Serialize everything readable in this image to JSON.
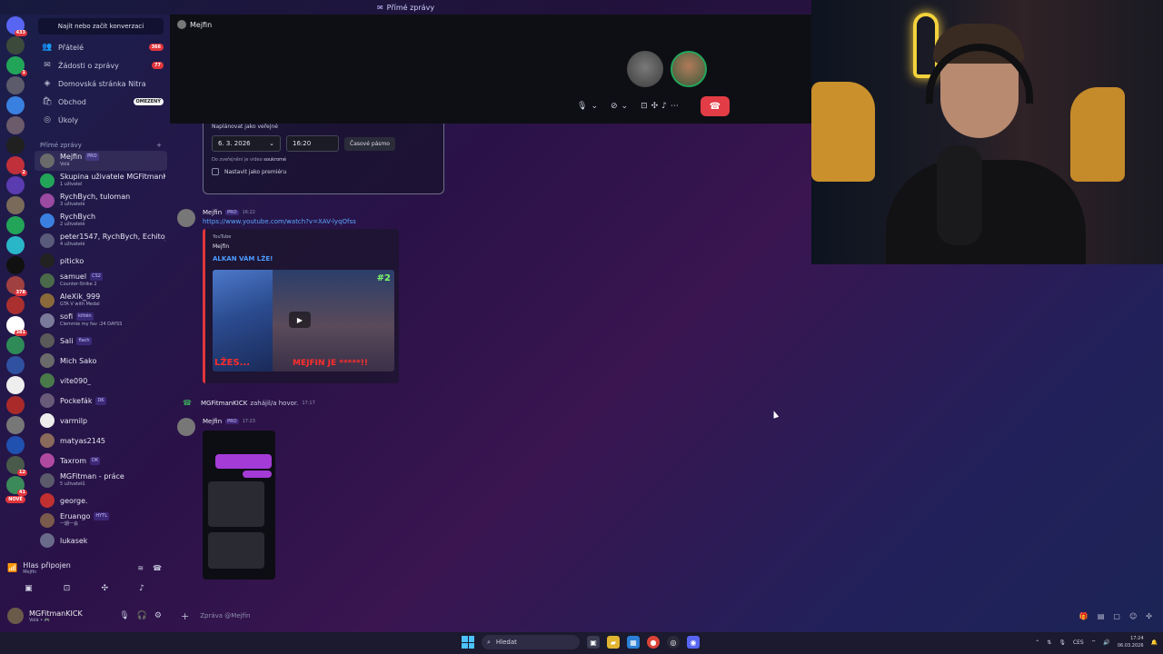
{
  "window": {
    "title": "Přímé zprávy"
  },
  "rail": {
    "servers": [
      {
        "badge": "433",
        "color": "#5865f2"
      },
      {
        "badge": "",
        "color": "#3c4a3c"
      },
      {
        "badge": "1",
        "color": "#23a559"
      },
      {
        "badge": "",
        "color": "#5b5b6b"
      },
      {
        "badge": "",
        "color": "#3a80e0"
      },
      {
        "badge": "",
        "color": "#6b5b6b"
      },
      {
        "badge": "",
        "color": "#202020"
      },
      {
        "badge": "2",
        "color": "#c0303a"
      },
      {
        "badge": "",
        "color": "#5b3bb0"
      },
      {
        "badge": "",
        "color": "#7a6a5a"
      },
      {
        "badge": "",
        "color": "#23a559"
      },
      {
        "badge": "",
        "color": "#29b6c8"
      },
      {
        "badge": "",
        "color": "#111111"
      },
      {
        "badge": "378",
        "color": "#a04040"
      },
      {
        "badge": "",
        "color": "#aa3030"
      },
      {
        "badge": "381",
        "color": "#ffffff"
      },
      {
        "badge": "",
        "color": "#2e8b57"
      },
      {
        "badge": "",
        "color": "#3050a0"
      },
      {
        "badge": "",
        "color": "#eeeeee"
      },
      {
        "badge": "",
        "color": "#aa2a2a"
      },
      {
        "badge": "",
        "color": "#777777"
      },
      {
        "badge": "",
        "color": "#2050b0"
      },
      {
        "badge": "12",
        "color": "#4a5a4a"
      },
      {
        "badge": "41",
        "color": "#3a8a5a"
      }
    ],
    "new_label": "NOVÉ"
  },
  "sidebar": {
    "search_label": "Najít nebo začít konverzaci",
    "nav": [
      {
        "label": "Přátelé",
        "icon": "friends-icon",
        "badge": "366"
      },
      {
        "label": "Žádosti o zprávy",
        "icon": "envelope-icon",
        "badge": "77"
      },
      {
        "label": "Domovská stránka Nitra",
        "icon": "nitro-icon",
        "badge": ""
      },
      {
        "label": "Obchod",
        "icon": "shop-icon",
        "badge": "OMEZENÝ"
      },
      {
        "label": "Úkoly",
        "icon": "quests-icon",
        "badge": ""
      }
    ],
    "dm_header": "Přímé zprávy",
    "dm_add": "+",
    "dms": [
      {
        "name": "Mejfin",
        "tag": "PRO",
        "status": "Volá",
        "color": "#6b6b6b",
        "active": true
      },
      {
        "name": "Skupina uživatele MGFitmanKI...",
        "tag": "",
        "status": "1 uživatel",
        "color": "#23a559"
      },
      {
        "name": "RychBych, tuloman",
        "tag": "",
        "status": "3 uživatelé",
        "color": "#9a4aa0"
      },
      {
        "name": "RychBych",
        "tag": "",
        "status": "2 uživatelé",
        "color": "#3a80e0"
      },
      {
        "name": "peter1547, RychBych, Echito_LI...",
        "tag": "",
        "status": "4 uživatelé",
        "color": "#5a5a7a"
      },
      {
        "name": "piticko",
        "tag": "",
        "status": "",
        "color": "#222"
      },
      {
        "name": "samuel",
        "tag": "CS2",
        "status": "Counter-Strike 2",
        "color": "#4a6a4a"
      },
      {
        "name": "AleXik_999",
        "tag": "",
        "status": "GTA V with Medal",
        "color": "#8a6a3a"
      },
      {
        "name": "sofi",
        "tag": "kittén",
        "status": "Clemmie my fav :24 DAYSS",
        "color": "#7a7a9a"
      },
      {
        "name": "Sali",
        "tag": "flach",
        "status": "",
        "color": "#5a5a5a"
      },
      {
        "name": "Mich Sako",
        "tag": "",
        "status": "",
        "color": "#6a6a6a"
      },
      {
        "name": "vite090_",
        "tag": "",
        "status": "",
        "color": "#4a7a4a"
      },
      {
        "name": "Pockefák",
        "tag": "DK",
        "status": "",
        "color": "#6a5a7a"
      },
      {
        "name": "varmilp",
        "tag": "",
        "status": "",
        "color": "#eee"
      },
      {
        "name": "matyas2145",
        "tag": "",
        "status": "",
        "color": "#8a6a5a"
      },
      {
        "name": "Taxrom",
        "tag": "DK",
        "status": "",
        "color": "#b04aa0"
      },
      {
        "name": "MGFitman - práce",
        "tag": "",
        "status": "5 uživatelů",
        "color": "#5a5a6a"
      },
      {
        "name": "george.",
        "tag": "",
        "status": "",
        "color": "#c03030"
      },
      {
        "name": "Eruango",
        "tag": "HYTL",
        "status": "一期一会",
        "color": "#7a5a4a"
      },
      {
        "name": "lukasek",
        "tag": "",
        "status": "",
        "color": "#6a6a8a"
      }
    ]
  },
  "voice": {
    "status": "Hlas připojen",
    "channel": "Mejfin"
  },
  "user": {
    "name": "MGFitmanKICK",
    "status": "Volá • 🎮"
  },
  "call": {
    "title": "Mejfin"
  },
  "schedule": {
    "heading": "Naplánovat jako veřejné",
    "date": "6. 3. 2026",
    "time": "16:20",
    "timezone_button": "Časové pásmo",
    "note_prefix": "Do zveřejnění je video",
    "note_value": "soukromé",
    "premiere_label": "Nastavit jako premiéru"
  },
  "messages": [
    {
      "author": "Mejfin",
      "tag": "PRO",
      "time": "16:22",
      "link": "https://www.youtube.com/watch?v=XAV-lyqOfss",
      "embed": {
        "provider": "YouTube",
        "author": "Mejfin",
        "title": "ALKAN VÁM LŽE!",
        "caption_left": "LŽES...",
        "caption_right": "MEJFIN JE *****!!",
        "number": "#2"
      }
    },
    {
      "author": "Mejfin",
      "tag": "PRO",
      "time": "17:23"
    }
  ],
  "call_event": {
    "user": "MGFitmanKICK",
    "text": "zahájil/a hovor.",
    "time": "17:17"
  },
  "composer": {
    "placeholder": "Zpráva @Mejfin"
  },
  "taskbar": {
    "search": "Hledat",
    "lang": "CES",
    "time": "17:24",
    "date": "06.03.2026"
  }
}
